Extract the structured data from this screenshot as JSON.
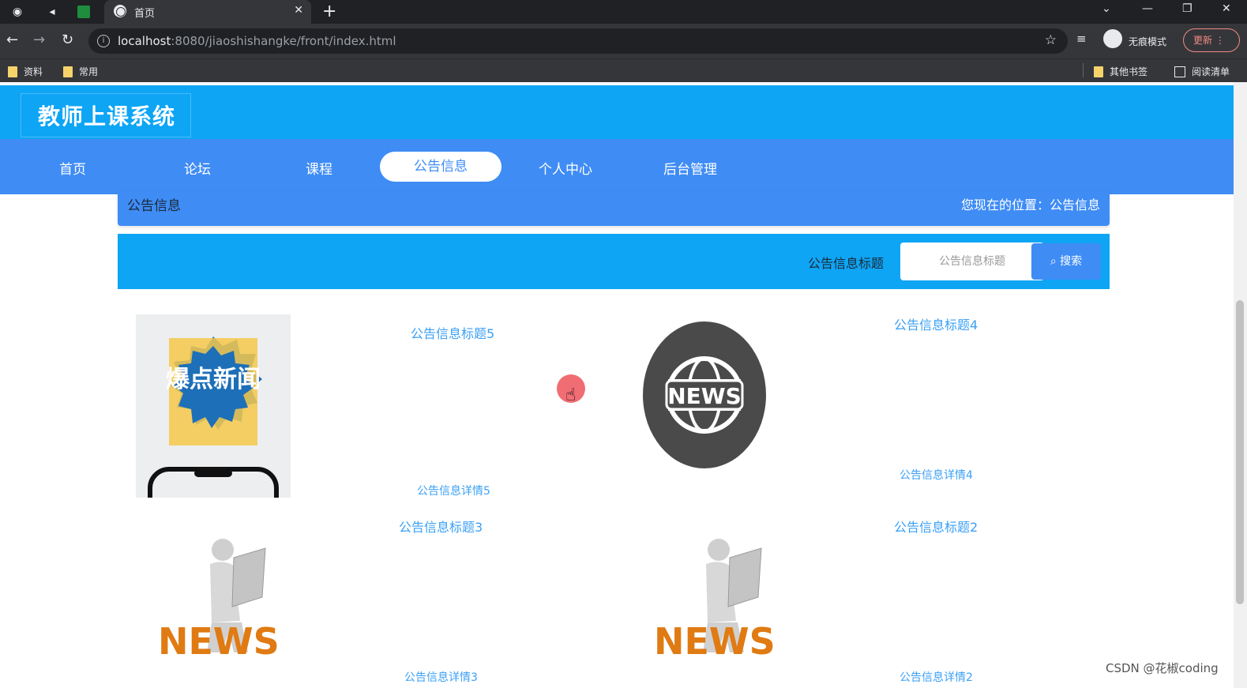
{
  "browser": {
    "tab_title": "首页",
    "url_host": "localhost",
    "url_path": ":8080/jiaoshishangke/front/index.html",
    "incognito_label": "无痕模式",
    "update_label": "更新",
    "bookmarks": [
      "资料",
      "常用"
    ],
    "bookmarks_right": [
      "其他书签",
      "阅读清单"
    ]
  },
  "site": {
    "title": "教师上课系统",
    "nav": [
      {
        "label": "首页",
        "active": false
      },
      {
        "label": "论坛",
        "active": false
      },
      {
        "label": "课程",
        "active": false
      },
      {
        "label": "公告信息",
        "active": true
      },
      {
        "label": "个人中心",
        "active": false
      },
      {
        "label": "后台管理",
        "active": false
      }
    ]
  },
  "breadcrumb": {
    "title": "公告信息",
    "location": "您现在的位置：公告信息"
  },
  "search": {
    "label": "公告信息标题",
    "placeholder": "公告信息标题",
    "button": "搜索"
  },
  "cards": [
    {
      "title": "公告信息标题5",
      "detail": "公告信息详情5",
      "image_text": "爆点新闻"
    },
    {
      "title": "公告信息标题4",
      "detail": "公告信息详情4",
      "image_text": "NEWS"
    },
    {
      "title": "公告信息标题3",
      "detail": "公告信息详情3",
      "image_text": "NEWS"
    },
    {
      "title": "公告信息标题2",
      "detail": "公告信息详情2",
      "image_text": "NEWS"
    }
  ],
  "watermark": "CSDN @花椒coding",
  "colors": {
    "header": "#0ea5f5",
    "nav": "#3f8cf5",
    "link": "#3ba0f5"
  }
}
